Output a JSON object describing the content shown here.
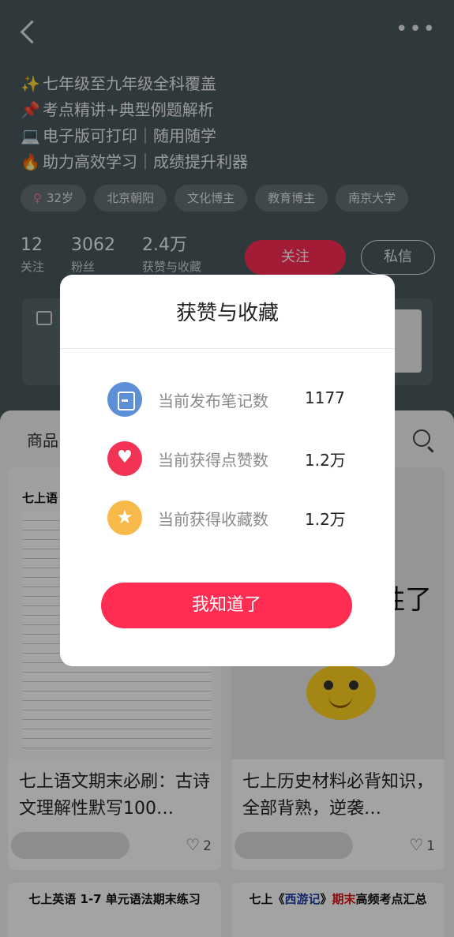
{
  "profile": {
    "bio": [
      {
        "emoji": "✨",
        "text": "七年级至九年级全科覆盖"
      },
      {
        "emoji": "📌",
        "text": "考点精讲+典型例题解析"
      },
      {
        "emoji": "💻",
        "text": "电子版可打印｜随用随学"
      },
      {
        "emoji": "🔥",
        "text": "助力高效学习｜成绩提升利器"
      }
    ],
    "tags": {
      "gender_symbol": "♀",
      "age": "32岁",
      "location": "北京朝阳",
      "tag_culture": "文化博主",
      "tag_education": "教育博主",
      "tag_school": "南京大学"
    },
    "stats": {
      "following_num": "12",
      "following_label": "关注",
      "followers_num": "3062",
      "followers_label": "粉丝",
      "likes_num": "2.4万",
      "likes_label": "获赞与收藏"
    },
    "follow_label": "关注",
    "message_label": "私信"
  },
  "content": {
    "tab_goods": "商品",
    "card_a": {
      "image_heading": "七上语",
      "title": "七上语文期末必刷：古诗文理解性默写100…",
      "likes": "2"
    },
    "card_b": {
      "big_text": "胜了",
      "title": "七上历史材料必背知识，全部背熟，逆袭…",
      "likes": "1"
    },
    "card_c": {
      "thumb_title": "七上英语 1-7 单元语法期末练习"
    },
    "card_d": {
      "thumb_pre": "七上《",
      "thumb_name": "西游记",
      "thumb_mid": "》",
      "thumb_red": "期末",
      "thumb_end": "高频考点汇总"
    }
  },
  "dialog": {
    "title": "获赞与收藏",
    "rows": [
      {
        "label": "当前发布笔记数",
        "value": "1177",
        "icon": "note-icon"
      },
      {
        "label": "当前获得点赞数",
        "value": "1.2万",
        "icon": "heart-icon"
      },
      {
        "label": "当前获得收藏数",
        "value": "1.2万",
        "icon": "star-icon"
      }
    ],
    "confirm_label": "我知道了"
  },
  "colors": {
    "accent": "#ff2d52",
    "note_icon": "#5d8fd6",
    "like_icon": "#f23355",
    "fav_icon": "#f7b94a"
  }
}
